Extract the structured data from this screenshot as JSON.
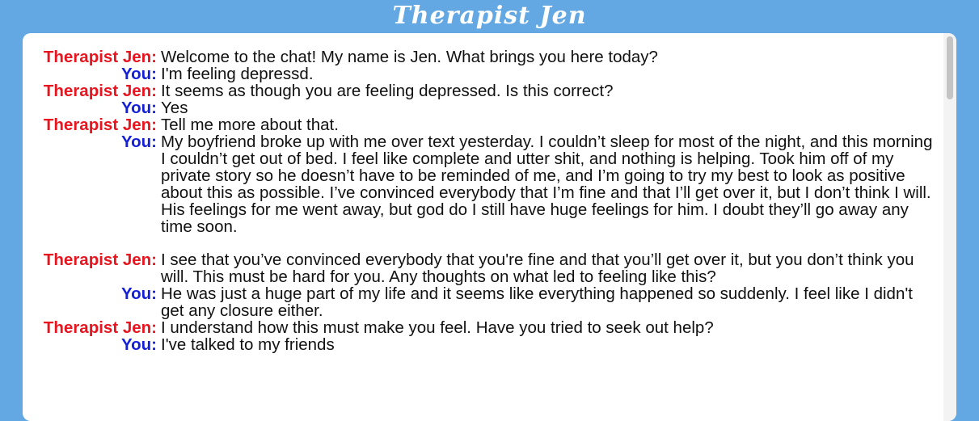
{
  "app": {
    "title": "Therapist Jen"
  },
  "messages": [
    {
      "speaker": "Therapist Jen:",
      "role": "jen",
      "text": "Welcome to the chat! My name is Jen. What brings you here today?"
    },
    {
      "speaker": "You:",
      "role": "you",
      "text": "I'm feeling depressd."
    },
    {
      "speaker": "Therapist Jen:",
      "role": "jen",
      "text": "It seems as though you are feeling depressed. Is this correct?"
    },
    {
      "speaker": "You:",
      "role": "you",
      "text": "Yes"
    },
    {
      "speaker": "Therapist Jen:",
      "role": "jen",
      "text": "Tell me more about that."
    },
    {
      "speaker": "You:",
      "role": "you",
      "text": "My boyfriend broke up with me over text yesterday. I couldn’t sleep for most of the night, and this morning I couldn’t get out of bed. I feel like complete and utter shit, and nothing is helping. Took him off of my private story so he doesn’t have to be reminded of me, and I’m going to try my best to look as positive about this as possible. I’ve convinced everybody that I’m fine and that I’ll get over it, but I don’t think I will. His feelings for me went away, but god do I still have huge feelings for him. I doubt they’ll go away any time soon."
    },
    {
      "speaker": "Therapist Jen:",
      "role": "jen",
      "text": "I see that you’ve convinced everybody that you're fine and that you’ll get over it, but you don’t think you will. This must be hard for you. Any thoughts on what led to feeling like this?"
    },
    {
      "speaker": "You:",
      "role": "you",
      "text": "He was just a huge part of my life and it seems like everything happened so suddenly. I feel like I didn't get any closure either."
    },
    {
      "speaker": "Therapist Jen:",
      "role": "jen",
      "text": "I understand how this must make you feel. Have you tried to seek out help?"
    },
    {
      "speaker": "You:",
      "role": "you",
      "text": "I've talked to my friends"
    }
  ],
  "colors": {
    "background": "#63a8e3",
    "jen_speaker": "#e8141e",
    "you_speaker": "#1420d8"
  }
}
